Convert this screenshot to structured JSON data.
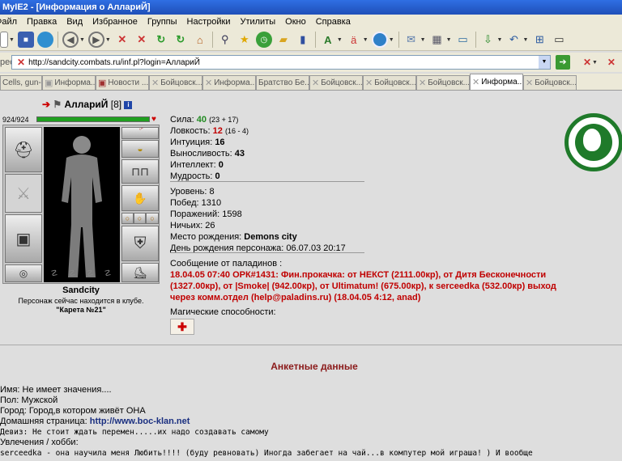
{
  "window": {
    "title": "MyIE2 - [Информация о АллариЙ]"
  },
  "menu": {
    "items": [
      "Файл",
      "Правка",
      "Вид",
      "Избранное",
      "Группы",
      "Настройки",
      "Утилиты",
      "Окно",
      "Справка"
    ]
  },
  "address": {
    "label": "рес",
    "url": "http://sandcity.combats.ru/inf.pl?login=АллариЙ"
  },
  "tabs": [
    {
      "label": "Cells, gun-ti"
    },
    {
      "label": "Информа..."
    },
    {
      "label": "Новости ..."
    },
    {
      "label": "Бойцовск..."
    },
    {
      "label": "Информа..."
    },
    {
      "label": "Братство Бе..."
    },
    {
      "label": "Бойцовск..."
    },
    {
      "label": "Бойцовск..."
    },
    {
      "label": "Бойцовск..."
    },
    {
      "label": "Информа..."
    },
    {
      "label": "Бойцовск..."
    }
  ],
  "character": {
    "name": "АллариЙ",
    "level": "[8]",
    "info_icon": "i",
    "hp_text": "924/924",
    "hp_fraction": 1.0,
    "city": "Sandcity",
    "location_line": "Персонаж сейчас находится в клубе.",
    "location_place": "\"Карета №21\""
  },
  "stats": {
    "strength_label": "Сила:",
    "strength_value": "40",
    "strength_detail": "(23 + 17)",
    "agility_label": "Ловкость:",
    "agility_value": "12",
    "agility_detail": "(16 - 4)",
    "intuition_label": "Интуиция:",
    "intuition_value": "16",
    "endurance_label": "Выносливость:",
    "endurance_value": "43",
    "intellect_label": "Интеллект:",
    "intellect_value": "0",
    "wisdom_label": "Мудрость:",
    "wisdom_value": "0"
  },
  "record": {
    "level": "Уровень: 8",
    "wins": "Побед: 1310",
    "losses": "Поражений: 1598",
    "draws": "Ничьих: 26",
    "birthplace_label": "Место рождения:",
    "birthplace_value": "Demons city",
    "birthday": "День рождения персонажа: 06.07.03 20:17"
  },
  "paladins": {
    "header": "Сообщение от паладинов :",
    "line1": "18.04.05 07:40 ОРК#1431: Фин.прокачка: от НЕКСТ (2111.00кр), от Дитя Бесконечности",
    "line2": "(1327.00кр), от |Smoke| (942.00кр), от Ultimatum! (675.00кр), к serceedka (532.00кр) выход",
    "line3": "через комм.отдел (help@paladins.ru) (18.04.05 4:12, anad)"
  },
  "magic": {
    "label": "Магические способности:"
  },
  "profile": {
    "title": "Анкетные данные",
    "name": "Имя: Не имеет значения....",
    "gender": "Пол: Мужской",
    "city": "Город: Город,в котором живёт ОНА",
    "homepage_label": "Домашняя страница:",
    "homepage_url": "http://www.boc-klan.net",
    "motto": "Девиз: Не стоит ждать перемен.....их надо создавать самому",
    "hobbies": "Увлечения / хобби:",
    "hobby_text": "serceedka - она научила меня Любить!!!! (буду ревновать) Иногда забегает на чай...в компутер мой играша! ) И вообще"
  }
}
